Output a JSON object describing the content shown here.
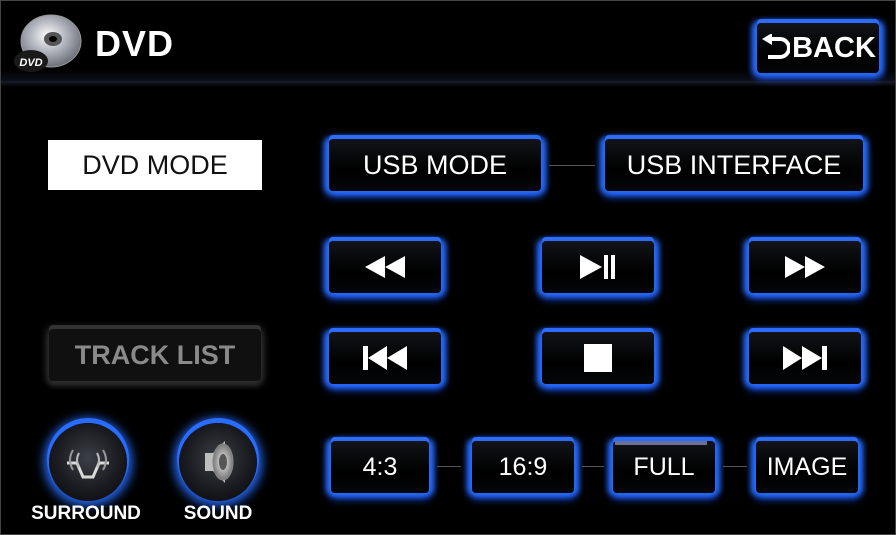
{
  "header": {
    "title": "DVD",
    "back_label": "BACK",
    "disc_icon_text": "DVD"
  },
  "mode": {
    "current_label": "DVD MODE",
    "usb_mode_label": "USB MODE",
    "usb_interface_label": "USB INTERFACE",
    "track_list_label": "TRACK LIST"
  },
  "controls": {
    "rewind_icon": "rewind-icon",
    "play_pause_icon": "play-pause-icon",
    "fast_forward_icon": "fast-forward-icon",
    "previous_icon": "skip-previous-icon",
    "stop_icon": "stop-icon",
    "next_icon": "skip-next-icon"
  },
  "aspect": {
    "ratio_43": "4:3",
    "ratio_169": "16:9",
    "full": "FULL",
    "image": "IMAGE",
    "selected": "FULL"
  },
  "audio": {
    "surround_label": "SURROUND",
    "sound_label": "SOUND"
  },
  "colors": {
    "accent_glow": "#2d6cff",
    "background": "#000000",
    "selected_mode_bg": "#ffffff"
  }
}
